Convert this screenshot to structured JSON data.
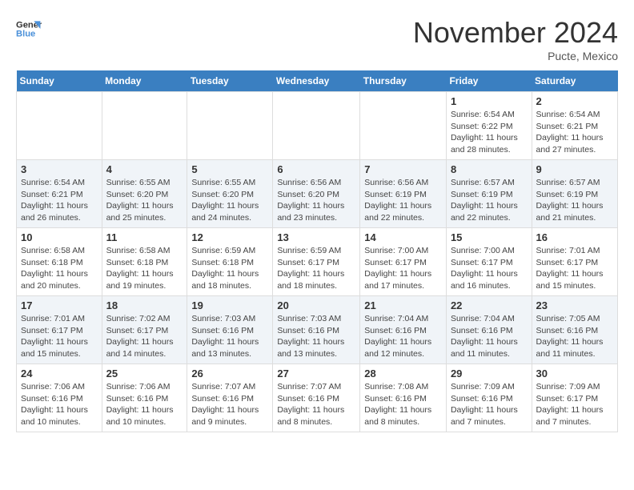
{
  "logo": {
    "line1": "General",
    "line2": "Blue"
  },
  "title": "November 2024",
  "subtitle": "Pucte, Mexico",
  "days_of_week": [
    "Sunday",
    "Monday",
    "Tuesday",
    "Wednesday",
    "Thursday",
    "Friday",
    "Saturday"
  ],
  "weeks": [
    [
      {
        "day": "",
        "info": ""
      },
      {
        "day": "",
        "info": ""
      },
      {
        "day": "",
        "info": ""
      },
      {
        "day": "",
        "info": ""
      },
      {
        "day": "",
        "info": ""
      },
      {
        "day": "1",
        "info": "Sunrise: 6:54 AM\nSunset: 6:22 PM\nDaylight: 11 hours and 28 minutes."
      },
      {
        "day": "2",
        "info": "Sunrise: 6:54 AM\nSunset: 6:21 PM\nDaylight: 11 hours and 27 minutes."
      }
    ],
    [
      {
        "day": "3",
        "info": "Sunrise: 6:54 AM\nSunset: 6:21 PM\nDaylight: 11 hours and 26 minutes."
      },
      {
        "day": "4",
        "info": "Sunrise: 6:55 AM\nSunset: 6:20 PM\nDaylight: 11 hours and 25 minutes."
      },
      {
        "day": "5",
        "info": "Sunrise: 6:55 AM\nSunset: 6:20 PM\nDaylight: 11 hours and 24 minutes."
      },
      {
        "day": "6",
        "info": "Sunrise: 6:56 AM\nSunset: 6:20 PM\nDaylight: 11 hours and 23 minutes."
      },
      {
        "day": "7",
        "info": "Sunrise: 6:56 AM\nSunset: 6:19 PM\nDaylight: 11 hours and 22 minutes."
      },
      {
        "day": "8",
        "info": "Sunrise: 6:57 AM\nSunset: 6:19 PM\nDaylight: 11 hours and 22 minutes."
      },
      {
        "day": "9",
        "info": "Sunrise: 6:57 AM\nSunset: 6:19 PM\nDaylight: 11 hours and 21 minutes."
      }
    ],
    [
      {
        "day": "10",
        "info": "Sunrise: 6:58 AM\nSunset: 6:18 PM\nDaylight: 11 hours and 20 minutes."
      },
      {
        "day": "11",
        "info": "Sunrise: 6:58 AM\nSunset: 6:18 PM\nDaylight: 11 hours and 19 minutes."
      },
      {
        "day": "12",
        "info": "Sunrise: 6:59 AM\nSunset: 6:18 PM\nDaylight: 11 hours and 18 minutes."
      },
      {
        "day": "13",
        "info": "Sunrise: 6:59 AM\nSunset: 6:17 PM\nDaylight: 11 hours and 18 minutes."
      },
      {
        "day": "14",
        "info": "Sunrise: 7:00 AM\nSunset: 6:17 PM\nDaylight: 11 hours and 17 minutes."
      },
      {
        "day": "15",
        "info": "Sunrise: 7:00 AM\nSunset: 6:17 PM\nDaylight: 11 hours and 16 minutes."
      },
      {
        "day": "16",
        "info": "Sunrise: 7:01 AM\nSunset: 6:17 PM\nDaylight: 11 hours and 15 minutes."
      }
    ],
    [
      {
        "day": "17",
        "info": "Sunrise: 7:01 AM\nSunset: 6:17 PM\nDaylight: 11 hours and 15 minutes."
      },
      {
        "day": "18",
        "info": "Sunrise: 7:02 AM\nSunset: 6:17 PM\nDaylight: 11 hours and 14 minutes."
      },
      {
        "day": "19",
        "info": "Sunrise: 7:03 AM\nSunset: 6:16 PM\nDaylight: 11 hours and 13 minutes."
      },
      {
        "day": "20",
        "info": "Sunrise: 7:03 AM\nSunset: 6:16 PM\nDaylight: 11 hours and 13 minutes."
      },
      {
        "day": "21",
        "info": "Sunrise: 7:04 AM\nSunset: 6:16 PM\nDaylight: 11 hours and 12 minutes."
      },
      {
        "day": "22",
        "info": "Sunrise: 7:04 AM\nSunset: 6:16 PM\nDaylight: 11 hours and 11 minutes."
      },
      {
        "day": "23",
        "info": "Sunrise: 7:05 AM\nSunset: 6:16 PM\nDaylight: 11 hours and 11 minutes."
      }
    ],
    [
      {
        "day": "24",
        "info": "Sunrise: 7:06 AM\nSunset: 6:16 PM\nDaylight: 11 hours and 10 minutes."
      },
      {
        "day": "25",
        "info": "Sunrise: 7:06 AM\nSunset: 6:16 PM\nDaylight: 11 hours and 10 minutes."
      },
      {
        "day": "26",
        "info": "Sunrise: 7:07 AM\nSunset: 6:16 PM\nDaylight: 11 hours and 9 minutes."
      },
      {
        "day": "27",
        "info": "Sunrise: 7:07 AM\nSunset: 6:16 PM\nDaylight: 11 hours and 8 minutes."
      },
      {
        "day": "28",
        "info": "Sunrise: 7:08 AM\nSunset: 6:16 PM\nDaylight: 11 hours and 8 minutes."
      },
      {
        "day": "29",
        "info": "Sunrise: 7:09 AM\nSunset: 6:16 PM\nDaylight: 11 hours and 7 minutes."
      },
      {
        "day": "30",
        "info": "Sunrise: 7:09 AM\nSunset: 6:17 PM\nDaylight: 11 hours and 7 minutes."
      }
    ]
  ]
}
